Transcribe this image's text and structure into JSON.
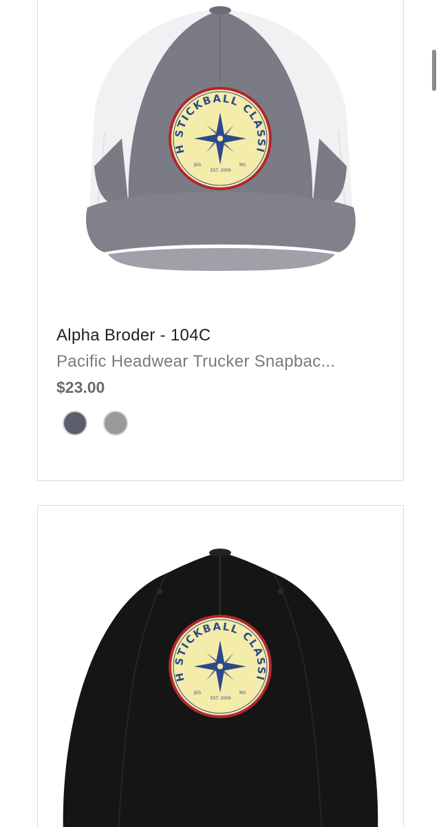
{
  "products": [
    {
      "brand": "Alpha Broder - 104C",
      "title": "Pacific Headwear Trucker Snapbac...",
      "price": "$23.00",
      "image_icon": "trucker-cap-image",
      "swatches": [
        {
          "name": "graphite",
          "color": "#5d5e6b"
        },
        {
          "name": "grey",
          "color": "#9a9a9c"
        }
      ]
    },
    {
      "image_icon": "black-cap-image"
    }
  ],
  "patch": {
    "text": "FH STICKBALL CLASSIC",
    "sub_left": "JEG",
    "sub_mid": "EST. 2009",
    "sub_right": "NG"
  },
  "colors": {
    "cap_front": "#7a7b85",
    "cap_mesh": "#f1f1f3",
    "cap_black": "#151515",
    "patch_fill": "#f4ecaa",
    "patch_border": "#b3262f",
    "patch_ink": "#2c4a8a"
  }
}
